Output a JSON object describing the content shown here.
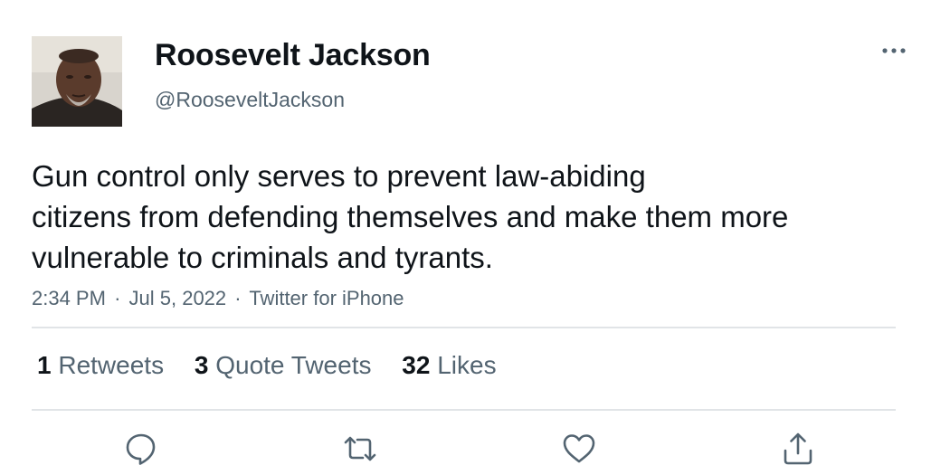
{
  "user": {
    "display_name": "Roosevelt Jackson",
    "handle": "@RooseveltJackson"
  },
  "tweet": {
    "text_lines": [
      "Gun control only serves to prevent law-abiding",
      "citizens from defending themselves and make them more",
      "vulnerable to criminals and tyrants."
    ],
    "time": "2:34 PM",
    "separator": "·",
    "date": "Jul 5, 2022",
    "source": "Twitter for iPhone"
  },
  "stats": {
    "retweets": {
      "count": "1",
      "label": "Retweets"
    },
    "quote_tweets": {
      "count": "3",
      "label": "Quote Tweets"
    },
    "likes": {
      "count": "32",
      "label": "Likes"
    }
  },
  "icons": {
    "more": "more-horizontal-icon",
    "reply": "reply-icon",
    "retweet": "retweet-icon",
    "like": "heart-icon",
    "share": "share-icon"
  },
  "colors": {
    "primary_text": "#0f1419",
    "secondary_text": "#536471",
    "divider": "#e1e4e7"
  }
}
